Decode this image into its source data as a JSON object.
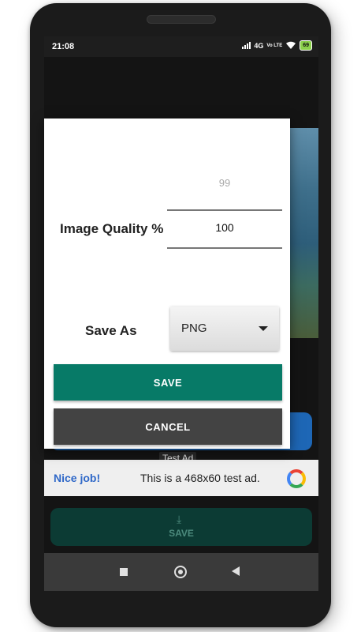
{
  "status_bar": {
    "time": "21:08",
    "network": "4G",
    "volte": "Vo LTE",
    "battery": "69"
  },
  "dialog": {
    "quality_label": "Image Quality %",
    "quality_prev_value": "99",
    "quality_value": "100",
    "save_as_label": "Save As",
    "format_selected": "PNG",
    "save_button": "SAVE",
    "cancel_button": "CANCEL"
  },
  "background": {
    "test_ad_label": "Test Ad",
    "ad_nice": "Nice job!",
    "ad_text": "This is a 468x60 test ad.",
    "save_label": "SAVE"
  },
  "colors": {
    "save_button": "#077a67",
    "cancel_button": "#434343",
    "ad_accent": "#2f68c8"
  }
}
